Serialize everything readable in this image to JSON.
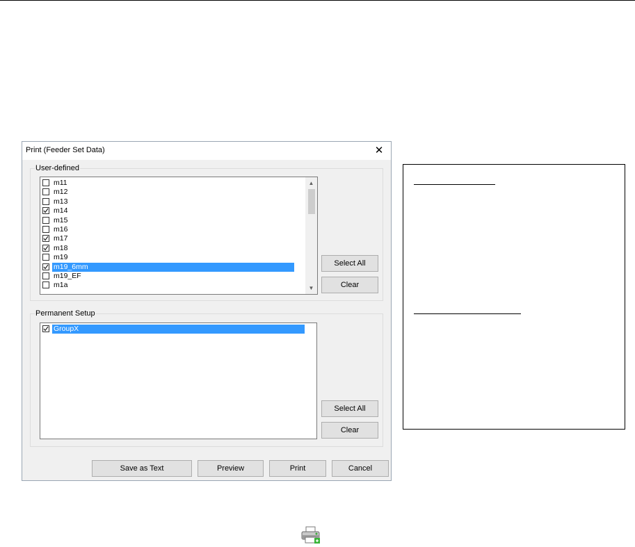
{
  "dialog": {
    "title": "Print (Feeder Set Data)",
    "close_glyph": "✕",
    "user_defined": {
      "label": "User-defined",
      "items": [
        {
          "label": "m11",
          "checked": false,
          "selected": false
        },
        {
          "label": "m12",
          "checked": false,
          "selected": false
        },
        {
          "label": "m13",
          "checked": false,
          "selected": false
        },
        {
          "label": "m14",
          "checked": true,
          "selected": false
        },
        {
          "label": "m15",
          "checked": false,
          "selected": false
        },
        {
          "label": "m16",
          "checked": false,
          "selected": false
        },
        {
          "label": "m17",
          "checked": true,
          "selected": false
        },
        {
          "label": "m18",
          "checked": true,
          "selected": false
        },
        {
          "label": "m19",
          "checked": false,
          "selected": false
        },
        {
          "label": "m19_6mm",
          "checked": true,
          "selected": true
        },
        {
          "label": "m19_EF",
          "checked": false,
          "selected": false
        },
        {
          "label": "m1a",
          "checked": false,
          "selected": false
        }
      ],
      "select_all_label": "Select All",
      "clear_label": "Clear"
    },
    "permanent_setup": {
      "label": "Permanent Setup",
      "items": [
        {
          "label": "GroupX",
          "checked": true,
          "selected": true
        }
      ],
      "select_all_label": "Select All",
      "clear_label": "Clear"
    },
    "footer": {
      "save_as_text_label": "Save as Text",
      "preview_label": "Preview",
      "print_label": "Print",
      "cancel_label": "Cancel"
    }
  },
  "colors": {
    "selection": "#3399ff",
    "button_face": "#e1e1e1",
    "dialog_bg": "#f0f0f0"
  },
  "icons": {
    "close": "close-icon",
    "checkmark": "checkmark-icon",
    "scroll_up": "chevron-up-icon",
    "scroll_down": "chevron-down-icon",
    "printer": "printer-icon"
  }
}
